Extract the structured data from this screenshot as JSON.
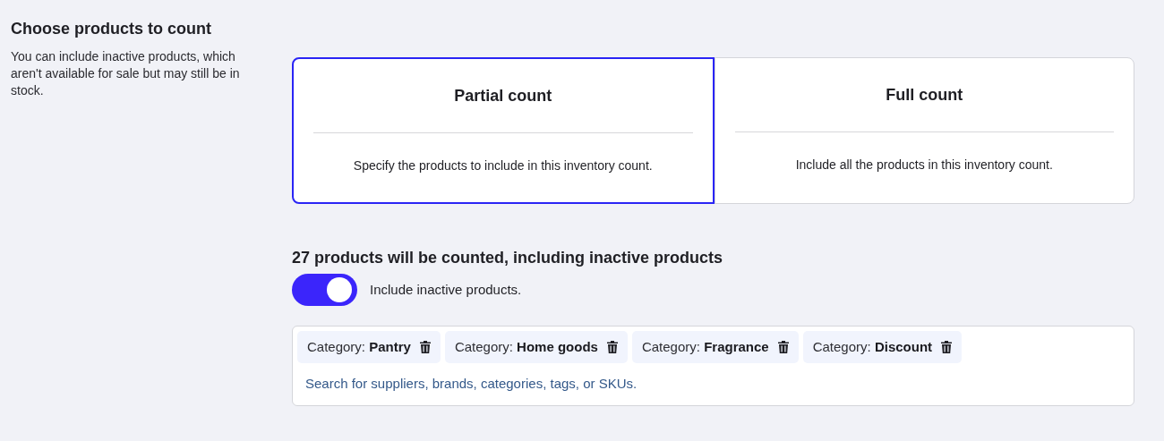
{
  "section": {
    "title": "Choose products to count",
    "description": "You can include inactive products, which aren't available for sale but may still be in stock."
  },
  "count_options": [
    {
      "title": "Partial count",
      "description": "Specify the products to include in this inventory count.",
      "selected": true
    },
    {
      "title": "Full count",
      "description": "Include all the products in this inventory count.",
      "selected": false
    }
  ],
  "summary": "27 products will be counted, including inactive products",
  "toggle": {
    "label": "Include inactive products.",
    "on": true
  },
  "filters": [
    {
      "text": "Category: **Pantry**"
    },
    {
      "text": "Category: **Home goods**"
    },
    {
      "text": "Category: **Fragrance**"
    },
    {
      "text": "Category: **Discount**"
    }
  ],
  "search": {
    "placeholder": "Search for suppliers, brands, categories, tags, or SKUs."
  }
}
